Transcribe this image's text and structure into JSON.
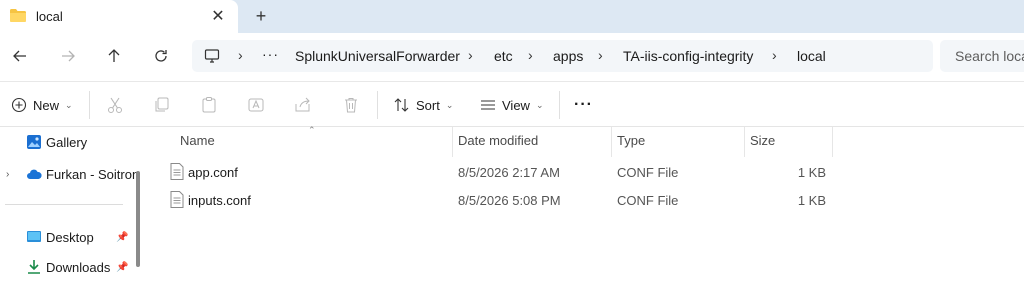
{
  "tab": {
    "title": "local",
    "close": "✕",
    "new": "+"
  },
  "address": {
    "more": "···",
    "crumbs": [
      "SplunkUniversalForwarder",
      "etc",
      "apps",
      "TA-iis-config-integrity",
      "local"
    ],
    "sep": "›"
  },
  "search": {
    "placeholder": "Search local"
  },
  "commands": {
    "new": "New",
    "sort": "Sort",
    "view": "View",
    "more": "···"
  },
  "sidebar": {
    "items": [
      {
        "label": "Gallery"
      },
      {
        "label": "Furkan - Soitron"
      },
      {
        "label": "Desktop"
      },
      {
        "label": "Downloads"
      }
    ]
  },
  "columns": {
    "name": "Name",
    "date": "Date modified",
    "type": "Type",
    "size": "Size"
  },
  "files": [
    {
      "name": "app.conf",
      "date": "8/5/2026 2:17 AM",
      "type": "CONF File",
      "size": "1 KB"
    },
    {
      "name": "inputs.conf",
      "date": "8/5/2026 5:08 PM",
      "type": "CONF File",
      "size": "1 KB"
    }
  ],
  "colors": {
    "titlebar": "#dde8f3",
    "folder": "#f6c443",
    "accent": "#0067c0"
  }
}
